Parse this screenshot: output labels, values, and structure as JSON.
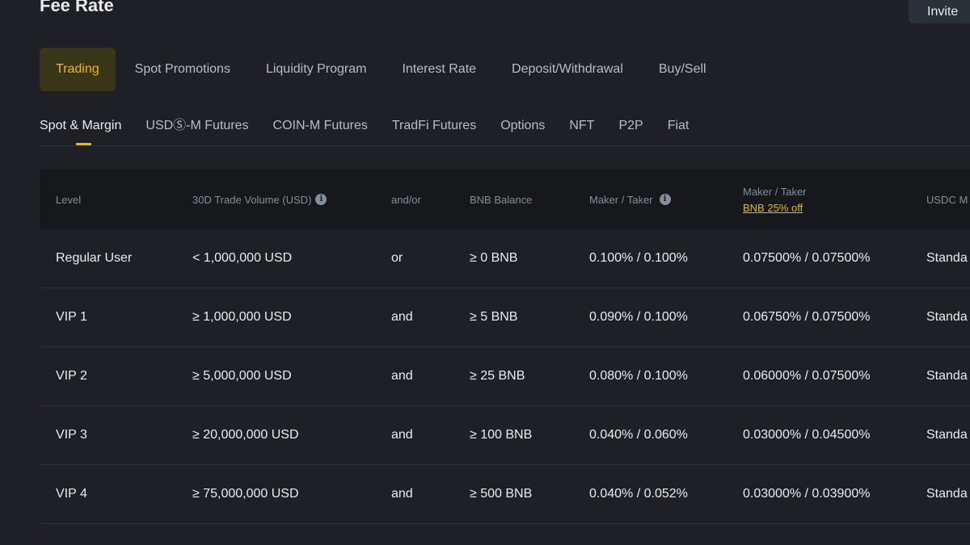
{
  "header": {
    "title": "Fee Rate",
    "invite_label": "Invite"
  },
  "primary_tabs": [
    {
      "label": "Trading",
      "active": true
    },
    {
      "label": "Spot Promotions",
      "active": false
    },
    {
      "label": "Liquidity Program",
      "active": false
    },
    {
      "label": "Interest Rate",
      "active": false
    },
    {
      "label": "Deposit/Withdrawal",
      "active": false
    },
    {
      "label": "Buy/Sell",
      "active": false
    }
  ],
  "secondary_tabs": [
    {
      "label": "Spot & Margin",
      "active": true
    },
    {
      "label": "USDⓈ-M Futures",
      "active": false
    },
    {
      "label": "COIN-M Futures",
      "active": false
    },
    {
      "label": "TradFi Futures",
      "active": false
    },
    {
      "label": "Options",
      "active": false
    },
    {
      "label": "NFT",
      "active": false
    },
    {
      "label": "P2P",
      "active": false
    },
    {
      "label": "Fiat",
      "active": false
    }
  ],
  "table": {
    "headers": {
      "level": "Level",
      "volume": "30D Trade Volume (USD)",
      "andor": "and/or",
      "bnb_balance": "BNB Balance",
      "maker_taker": "Maker / Taker",
      "maker_taker_bnb": "Maker / Taker",
      "bnb_discount": "BNB 25% off",
      "usdc": "USDC M"
    },
    "rows": [
      {
        "level": "Regular User",
        "volume": "< 1,000,000 USD",
        "andor": "or",
        "bnb": "≥ 0 BNB",
        "fee": "0.100% / 0.100%",
        "fee_bnb": "0.07500% / 0.07500%",
        "usdc": "Standa"
      },
      {
        "level": "VIP 1",
        "volume": "≥ 1,000,000 USD",
        "andor": "and",
        "bnb": "≥ 5 BNB",
        "fee": "0.090% / 0.100%",
        "fee_bnb": "0.06750% / 0.07500%",
        "usdc": "Standa"
      },
      {
        "level": "VIP 2",
        "volume": "≥ 5,000,000 USD",
        "andor": "and",
        "bnb": "≥ 25 BNB",
        "fee": "0.080% / 0.100%",
        "fee_bnb": "0.06000% / 0.07500%",
        "usdc": "Standa"
      },
      {
        "level": "VIP 3",
        "volume": "≥ 20,000,000 USD",
        "andor": "and",
        "bnb": "≥ 100 BNB",
        "fee": "0.040% / 0.060%",
        "fee_bnb": "0.03000% / 0.04500%",
        "usdc": "Standa"
      },
      {
        "level": "VIP 4",
        "volume": "≥ 75,000,000 USD",
        "andor": "and",
        "bnb": "≥ 500 BNB",
        "fee": "0.040% / 0.052%",
        "fee_bnb": "0.03000% / 0.03900%",
        "usdc": "Standa"
      }
    ]
  },
  "colors": {
    "background": "#1e2026",
    "accent": "#f0b90b",
    "header_bg": "#16181c",
    "active_tab_bg": "#3a3418"
  }
}
